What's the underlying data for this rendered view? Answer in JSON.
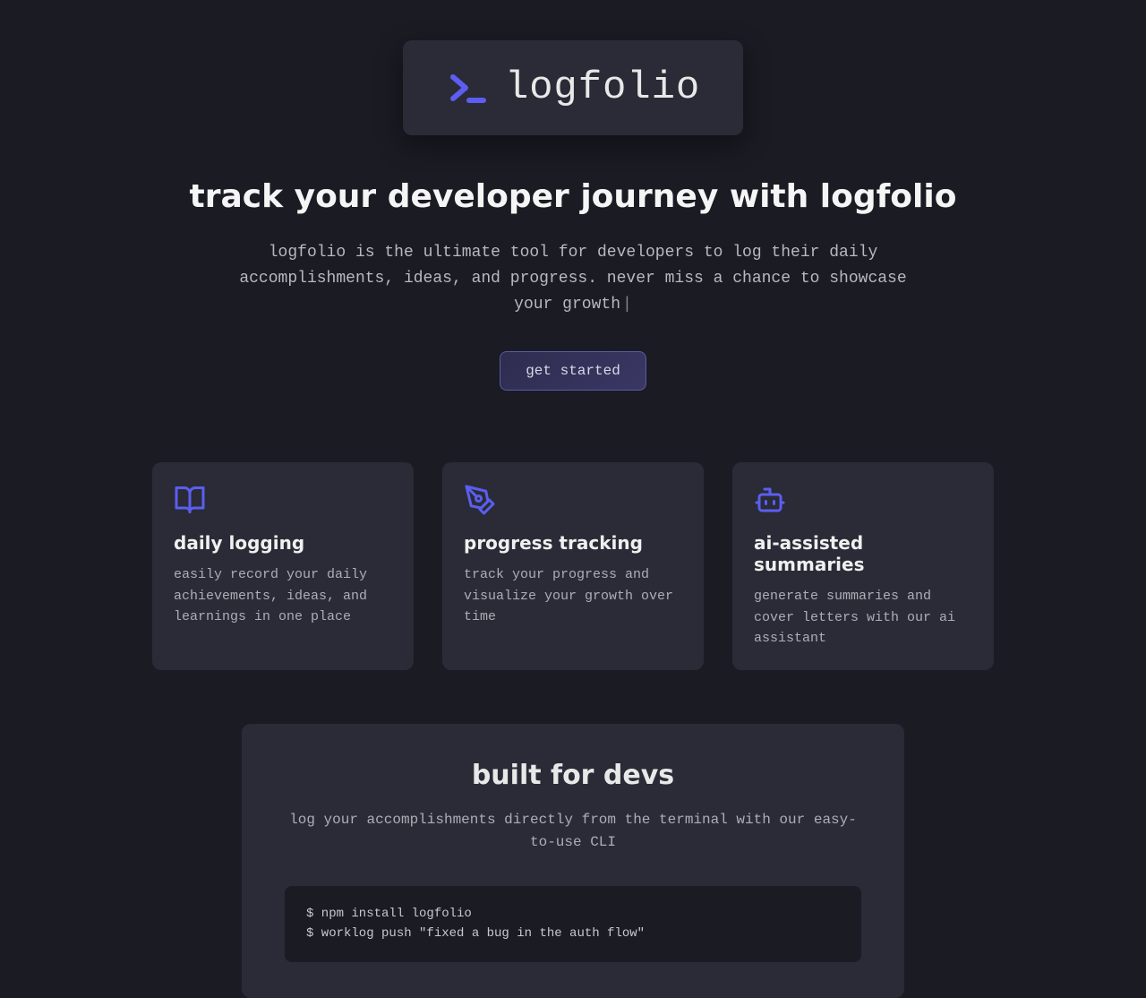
{
  "brand": "logfolio",
  "hero": {
    "title": "track your developer journey with logfolio",
    "subtitle": "logfolio is the ultimate tool for developers to log their daily accomplishments, ideas, and progress. never miss a chance to showcase your growth",
    "cta": "get started"
  },
  "features": [
    {
      "icon": "book-open-icon",
      "title": "daily logging",
      "body": "easily record your daily achievements, ideas, and learnings in one place"
    },
    {
      "icon": "pen-tool-icon",
      "title": "progress tracking",
      "body": "track your progress and visualize your growth over time"
    },
    {
      "icon": "bot-icon",
      "title": "ai-assisted summaries",
      "body": "generate summaries and cover letters with our ai assistant"
    }
  ],
  "devs": {
    "title": "built for devs",
    "lead": "log your accomplishments directly from the terminal with our easy-to-use CLI",
    "code": [
      "$ npm install logfolio",
      "$ worklog push \"fixed a bug in the auth flow\""
    ]
  }
}
